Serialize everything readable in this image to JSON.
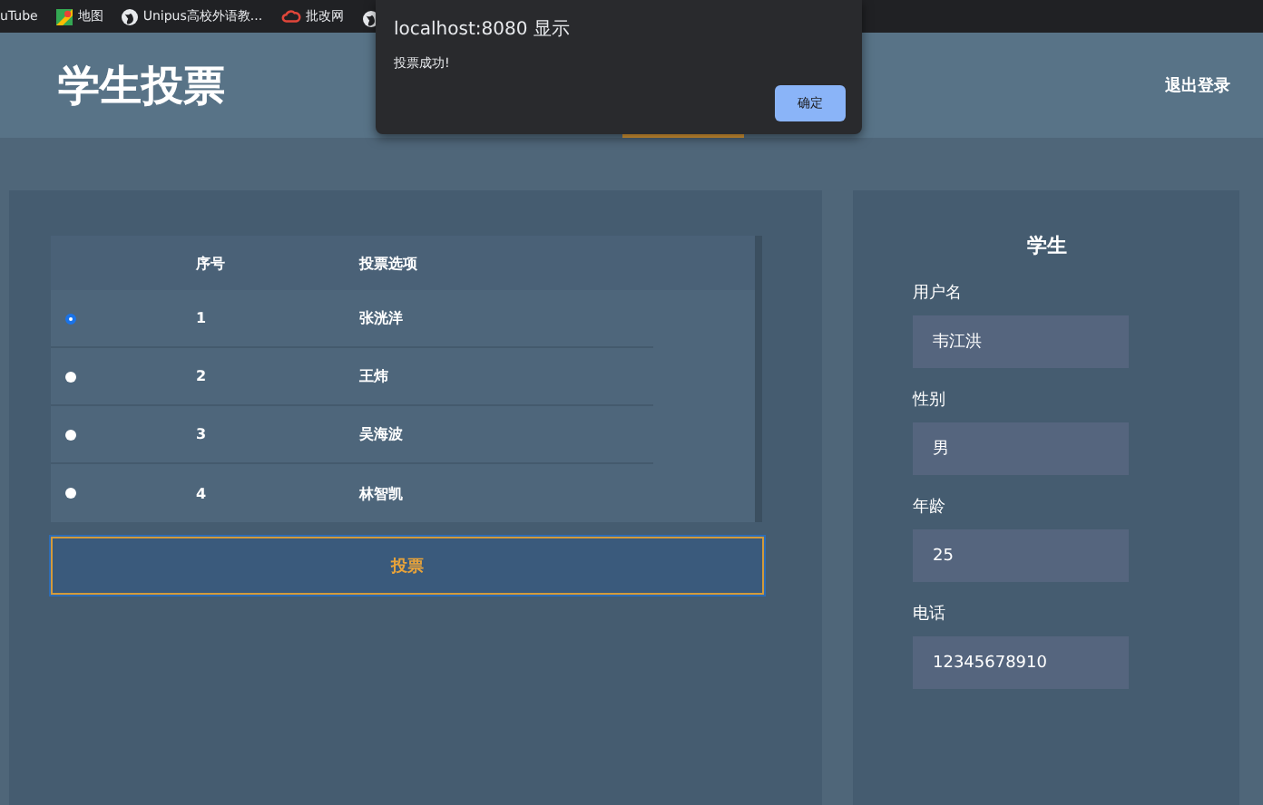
{
  "bookmarks": [
    {
      "label": "uTube",
      "kind": "text"
    },
    {
      "label": "地图",
      "kind": "map"
    },
    {
      "label": "Unipus高校外语教...",
      "kind": "globe"
    },
    {
      "label": "批改网",
      "kind": "cloud"
    },
    {
      "kind": "globe-cut"
    }
  ],
  "header": {
    "title": "学生投票",
    "logout": "退出登录"
  },
  "vote_table": {
    "columns": [
      "序号",
      "投票选项"
    ],
    "rows": [
      {
        "number": "1",
        "option": "张洸洋",
        "selected": true
      },
      {
        "number": "2",
        "option": "王炜",
        "selected": false
      },
      {
        "number": "3",
        "option": "吴海波",
        "selected": false
      },
      {
        "number": "4",
        "option": "林智凯",
        "selected": false
      }
    ],
    "submit": "投票"
  },
  "profile": {
    "title": "学生",
    "fields": [
      {
        "label": "用户名",
        "value": "韦江洪"
      },
      {
        "label": "性别",
        "value": "男"
      },
      {
        "label": "年龄",
        "value": "25"
      },
      {
        "label": "电话",
        "value": "12345678910"
      }
    ]
  },
  "dialog": {
    "title": "localhost:8080 显示",
    "message": "投票成功!",
    "ok": "确定"
  }
}
